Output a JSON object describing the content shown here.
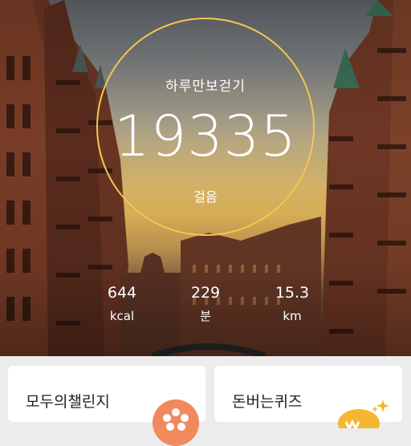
{
  "walk": {
    "title": "하루만보걷기",
    "steps": "19335",
    "steps_unit": "걸음"
  },
  "stats": {
    "calories": {
      "value": "644",
      "unit": "kcal"
    },
    "minutes": {
      "value": "229",
      "unit": "분"
    },
    "distance": {
      "value": "15.3",
      "unit": "km"
    }
  },
  "cards": [
    {
      "label": "모두의챌린지",
      "icon": "flower-icon"
    },
    {
      "label": "돈버는퀴즈",
      "icon": "coin-sparkle-icon"
    }
  ],
  "colors": {
    "ring": "#f2c94c",
    "flower_icon": "#f08a5d",
    "coin_icon": "#f5b731"
  }
}
